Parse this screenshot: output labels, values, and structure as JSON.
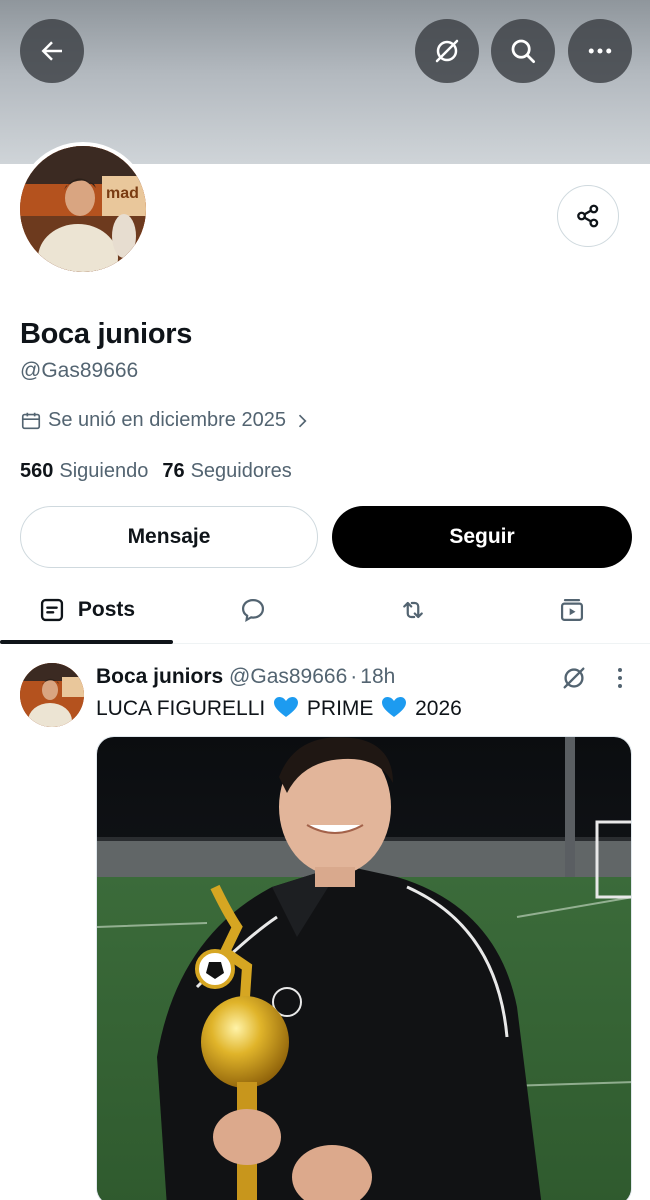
{
  "header": {
    "back_icon": "arrow-left-icon",
    "grok_icon": "grok-icon",
    "search_icon": "search-icon",
    "more_icon": "more-horizontal-icon"
  },
  "profile": {
    "display_name": "Boca juniors",
    "handle": "@Gas89666",
    "joined": "Se unió en diciembre 2025",
    "following_count": "560",
    "following_label": "Siguiendo",
    "followers_count": "76",
    "followers_label": "Seguidores",
    "share_icon": "share-icon",
    "calendar_icon": "calendar-icon",
    "avatar_text": "mad"
  },
  "actions": {
    "message_label": "Mensaje",
    "follow_label": "Seguir"
  },
  "tabs": [
    {
      "label": "Posts",
      "icon": "posts-icon",
      "selected": true
    },
    {
      "label": "",
      "icon": "replies-icon"
    },
    {
      "label": "",
      "icon": "reposts-icon"
    },
    {
      "label": "",
      "icon": "media-icon"
    }
  ],
  "post": {
    "author_name": "Boca juniors",
    "author_handle": "@Gas89666",
    "separator": "·",
    "time": "18h",
    "text_part1": "LUCA FIGURELLI",
    "text_part2": "PRIME",
    "text_part3": "2026",
    "emoji": "blue-heart-icon"
  },
  "colors": {
    "text_primary": "#0f1419",
    "text_secondary": "#536471",
    "border": "#cfd9de",
    "follow_bg": "#000000",
    "heart_blue": "#1d9bf0"
  }
}
